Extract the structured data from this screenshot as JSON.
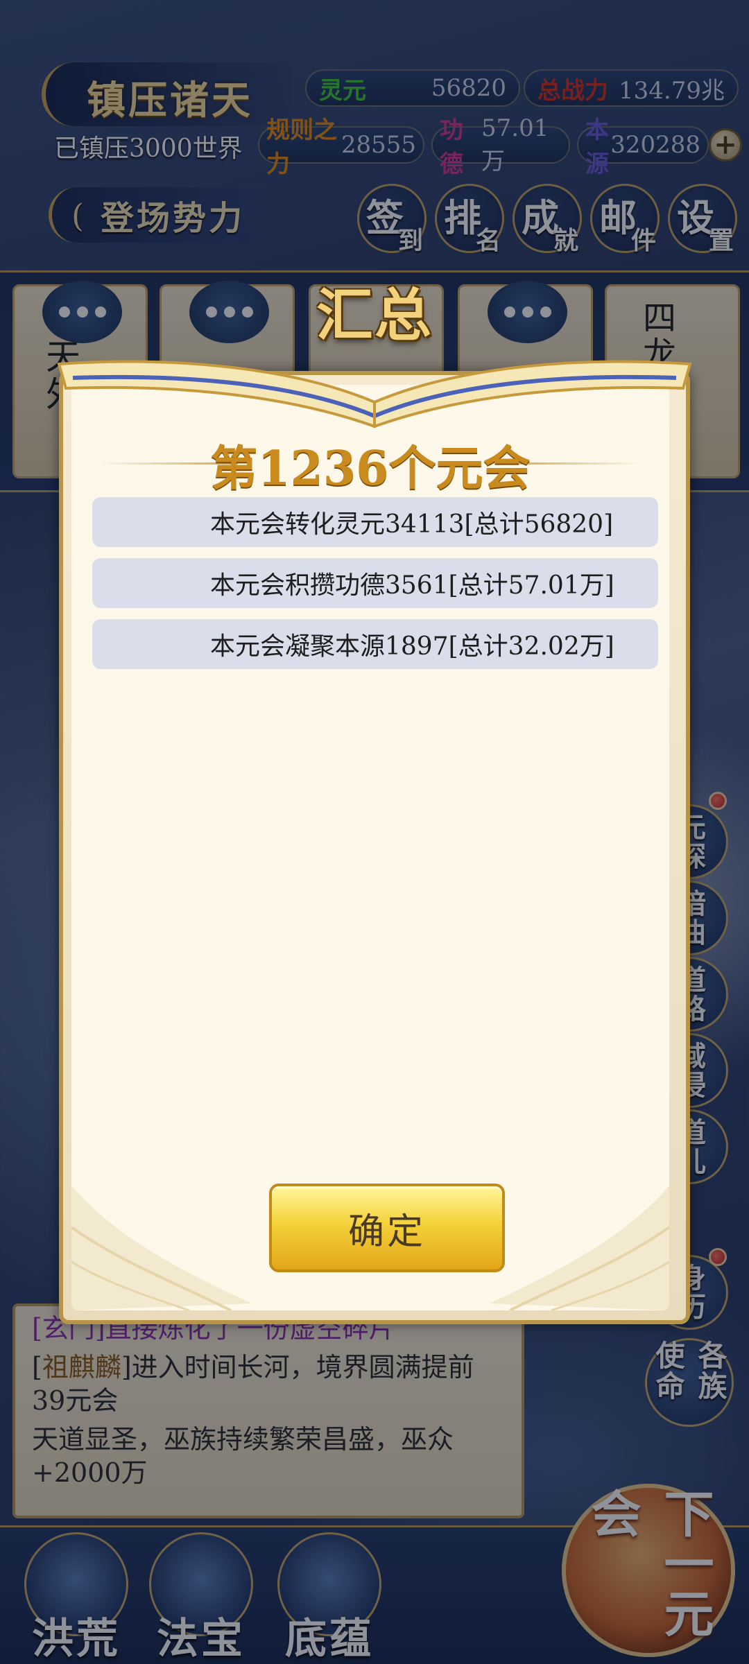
{
  "header": {
    "title": "镇压诸天",
    "conquered": "已镇压3000世界",
    "enter_label": "登场势力",
    "resources": {
      "lingyuan_label": "灵元",
      "lingyuan_value": "56820",
      "power_label": "总战力",
      "power_value": "134.79兆",
      "rules_label": "规则之力",
      "rules_value": "28555",
      "merit_label": "功德",
      "merit_value": "57.01万",
      "source_label": "本源",
      "source_value": "320288",
      "plus": "+"
    },
    "buttons": [
      {
        "c1": "签",
        "c2": "到"
      },
      {
        "c1": "排",
        "c2": "名"
      },
      {
        "c1": "成",
        "c2": "就"
      },
      {
        "c1": "邮",
        "c2": "件"
      },
      {
        "c1": "设",
        "c2": "置"
      }
    ]
  },
  "factions": [
    {
      "text": "天外"
    },
    {
      "text": ""
    },
    {
      "text": ""
    },
    {
      "text": ""
    },
    {
      "text": "四龙族"
    }
  ],
  "side_buttons": [
    {
      "label": "元探"
    },
    {
      "label": "暗曲"
    },
    {
      "label": "道路"
    },
    {
      "label": "域侵"
    },
    {
      "label": "道儿"
    },
    {
      "label": "身历"
    },
    {
      "label": "各族使命"
    }
  ],
  "log": {
    "line1_tag": "[玄门]",
    "line1_text": "直接炼化了一份虚空碎片",
    "line2_bracket_open": "[",
    "line2_name": "祖麒麟",
    "line2_bracket_close": "]",
    "line2_text": "进入时间长河，境界圆满提前39元会",
    "line3_text": "天道显圣，巫族持续繁荣昌盛，巫众+2000万"
  },
  "bottom_nav": {
    "items": [
      "洪荒",
      "法宝",
      "底蕴"
    ],
    "next_label": "下一元会"
  },
  "modal": {
    "tab_title": "汇总",
    "heading": "第1236个元会",
    "rows": [
      "本元会转化灵元34113[总计56820]",
      "本元会积攒功德3561[总计57.01万]",
      "本元会凝聚本源1897[总计32.02万]"
    ],
    "confirm_label": "确定"
  },
  "colors": {
    "gold": "#f5dd97",
    "lingyuan": "#41c93b",
    "power": "#d4301c",
    "rules": "#e38a12",
    "merit": "#d23b8c",
    "source": "#6c5ad8",
    "confirm": "#f5d23a"
  }
}
